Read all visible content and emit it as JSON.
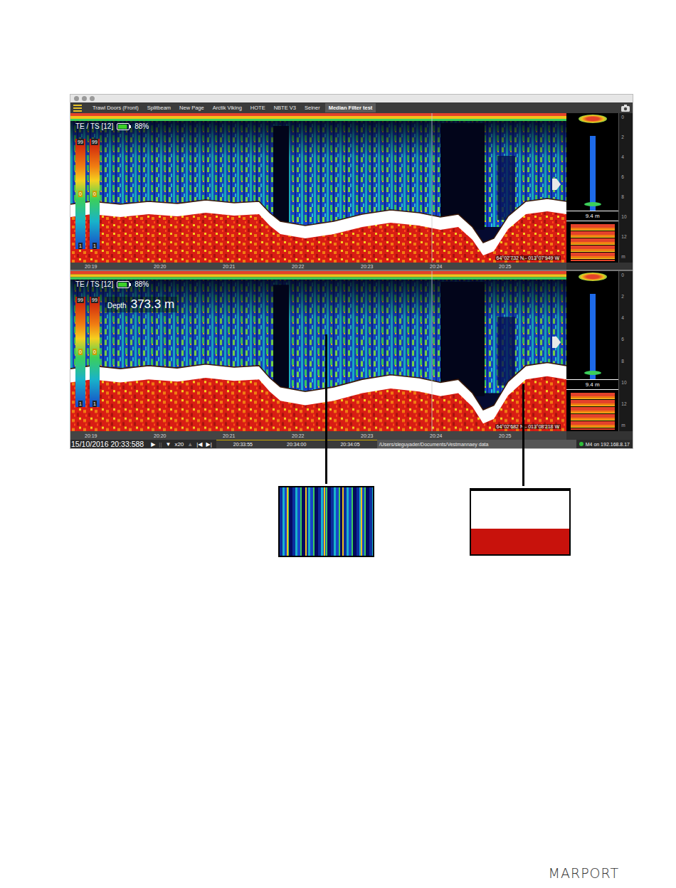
{
  "tabs": [
    {
      "label": "Trawl Doors (Front)",
      "selected": false
    },
    {
      "label": "Splitbeam",
      "selected": false
    },
    {
      "label": "New Page",
      "selected": false
    },
    {
      "label": "Arctik Viking",
      "selected": false
    },
    {
      "label": "HOTE",
      "selected": false
    },
    {
      "label": "NBTE V3",
      "selected": false
    },
    {
      "label": "Seiner",
      "selected": false
    },
    {
      "label": "Median Filter test",
      "selected": true
    }
  ],
  "panels": [
    {
      "mode": "TE / TS [12]",
      "battery": "88%",
      "battery_level": 0.88,
      "scales": [
        {
          "top": "99",
          "mid": "0",
          "bottom": "1"
        },
        {
          "top": "99",
          "mid": "0",
          "bottom": "1"
        }
      ],
      "depth": null,
      "position": "64°02'732 N - 013°07'949 W",
      "net_opening": "9.4 m",
      "depth_axis": [
        "0",
        "2",
        "4",
        "6",
        "8",
        "10",
        "12",
        "m"
      ],
      "time_ticks": [
        "20:19",
        "20:20",
        "20:21",
        "20:22",
        "20:23",
        "20:24",
        "20:25"
      ]
    },
    {
      "mode": "TE / TS [12]",
      "battery": "88%",
      "battery_level": 0.88,
      "scales": [
        {
          "top": "99",
          "mid": "0",
          "bottom": "1"
        },
        {
          "top": "99",
          "mid": "0",
          "bottom": "1"
        }
      ],
      "depth": {
        "label": "Depth",
        "value": "373.3 m"
      },
      "position": "64°02'682 N - 013°08'218 W",
      "net_opening": "9.4 m",
      "depth_axis": [
        "0",
        "2",
        "4",
        "6",
        "8",
        "10",
        "12",
        "m"
      ],
      "time_ticks": [
        "20:19",
        "20:20",
        "20:21",
        "20:22",
        "20:23",
        "20:24",
        "20:25"
      ]
    }
  ],
  "status_bar": {
    "timestamp": "15/10/2016 20:33:588",
    "controls": [
      {
        "label": "▶",
        "disabled": false
      },
      {
        "label": "||",
        "disabled": true
      },
      {
        "label": "▼",
        "disabled": false
      },
      {
        "label": "x20",
        "disabled": false
      },
      {
        "label": "▲",
        "disabled": true
      },
      {
        "label": "|◀",
        "disabled": false
      },
      {
        "label": "▶|",
        "disabled": false
      }
    ],
    "timeline_ticks": [
      "20:33:55",
      "20:34:00",
      "20:34:05"
    ],
    "file_path": "/Users/sleguyader/Documents/Vestmannaey data",
    "connection": {
      "label": "M4 on 192.168.8.17",
      "connected": true
    }
  },
  "logo": "MARPORT"
}
